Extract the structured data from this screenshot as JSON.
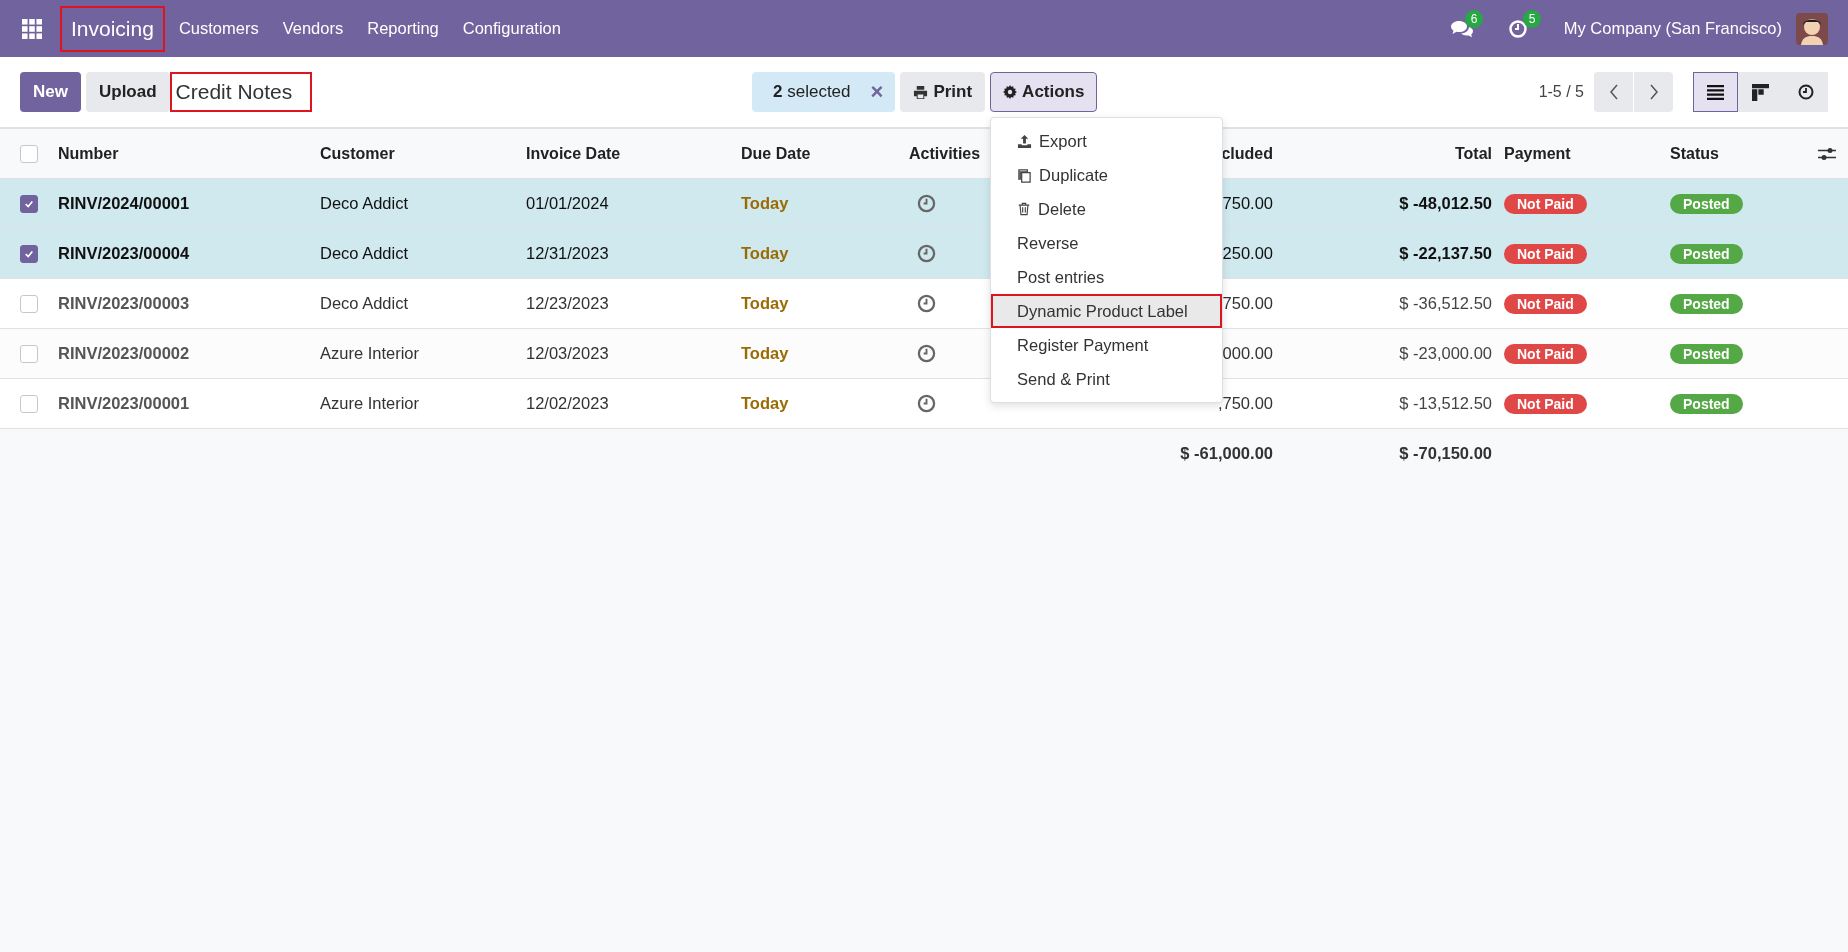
{
  "navbar": {
    "app": "Invoicing",
    "app_annotated": true,
    "menu": [
      "Customers",
      "Vendors",
      "Reporting",
      "Configuration"
    ],
    "messages_count": "6",
    "activities_count": "5",
    "company": "My Company (San Francisco)"
  },
  "control_panel": {
    "buttons": [
      {
        "label": "New",
        "kind": "primary"
      },
      {
        "label": "Upload",
        "kind": "secondary"
      }
    ],
    "title": "Credit Notes",
    "title_annotated": true,
    "selection_count": "2",
    "selection_label": "selected",
    "clear": "×",
    "print": "Print",
    "actions": "Actions",
    "pager": "1-5 / 5",
    "views": [
      {
        "kind": "list",
        "selected": true
      },
      {
        "kind": "kanban",
        "selected": false
      },
      {
        "kind": "activity",
        "selected": false
      }
    ]
  },
  "actions_menu": [
    {
      "label": "Export",
      "kind": "upload",
      "highlighted": false,
      "annotated": false
    },
    {
      "label": "Duplicate",
      "kind": "copy",
      "highlighted": false,
      "annotated": false
    },
    {
      "label": "Delete",
      "kind": "trash",
      "highlighted": false,
      "annotated": false
    },
    {
      "label": "Reverse",
      "kind": "plain",
      "highlighted": false,
      "annotated": false
    },
    {
      "label": "Post entries",
      "kind": "plain",
      "highlighted": false,
      "annotated": false
    },
    {
      "label": "Dynamic Product Label",
      "kind": "plain",
      "highlighted": true,
      "annotated": true
    },
    {
      "label": "Register Payment",
      "kind": "plain",
      "highlighted": false,
      "annotated": false
    },
    {
      "label": "Send & Print",
      "kind": "plain",
      "highlighted": false,
      "annotated": false
    }
  ],
  "table": {
    "all_selected": false,
    "columns": [
      "Number",
      "Customer",
      "Invoice Date",
      "Due Date",
      "Activities",
      "cluded",
      "Total",
      "Payment",
      "Status"
    ],
    "rows": [
      {
        "selected": true,
        "number": "RINV/2024/00001",
        "customer": "Deco Addict",
        "invoice_date": "01/01/2024",
        "due_date": "Today",
        "tax_excluded": "750.00",
        "total": "$ -48,012.50",
        "payment": "Not Paid",
        "status": "Posted"
      },
      {
        "selected": true,
        "number": "RINV/2023/00004",
        "customer": "Deco Addict",
        "invoice_date": "12/31/2023",
        "due_date": "Today",
        "tax_excluded": "250.00",
        "total": "$ -22,137.50",
        "payment": "Not Paid",
        "status": "Posted"
      },
      {
        "selected": false,
        "number": "RINV/2023/00003",
        "customer": "Deco Addict",
        "invoice_date": "12/23/2023",
        "due_date": "Today",
        "tax_excluded": "750.00",
        "total": "$ -36,512.50",
        "payment": "Not Paid",
        "status": "Posted"
      },
      {
        "selected": false,
        "number": "RINV/2023/00002",
        "customer": "Azure Interior",
        "invoice_date": "12/03/2023",
        "due_date": "Today",
        "tax_excluded": "000.00",
        "total": "$ -23,000.00",
        "payment": "Not Paid",
        "status": "Posted"
      },
      {
        "selected": false,
        "number": "RINV/2023/00001",
        "customer": "Azure Interior",
        "invoice_date": "12/02/2023",
        "due_date": "Today",
        "tax_excluded": ",750.00",
        "total": "$ -13,512.50",
        "payment": "Not Paid",
        "status": "Posted"
      }
    ],
    "totals": {
      "tax_excluded": "$ -61,000.00",
      "total": "$ -70,150.00"
    }
  }
}
